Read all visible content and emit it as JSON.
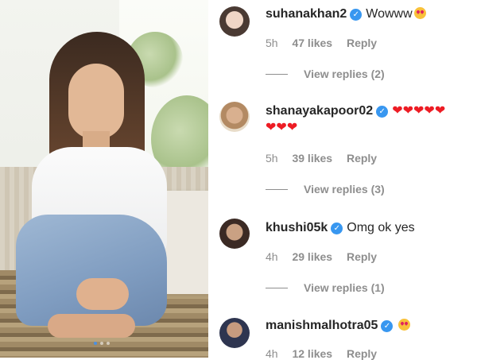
{
  "photo": {
    "carousel_dots": 3,
    "active_dot": 0
  },
  "comments": [
    {
      "username": "suhanakhan2",
      "text": "Wowww",
      "emoji": "heart-eyes",
      "time": "5h",
      "likes": "47 likes",
      "reply": "Reply",
      "view_replies": "View replies (2)"
    },
    {
      "username": "shanayakapoor02",
      "text": "❤❤❤❤❤",
      "text2": "❤❤❤",
      "time": "5h",
      "likes": "39 likes",
      "reply": "Reply",
      "view_replies": "View replies (3)"
    },
    {
      "username": "khushi05k",
      "text": "Omg ok yes",
      "time": "4h",
      "likes": "29 likes",
      "reply": "Reply",
      "view_replies": "View replies (1)"
    },
    {
      "username": "manishmalhotra05",
      "text": "",
      "emoji": "heart-eyes",
      "time": "4h",
      "likes": "12 likes",
      "reply": "Reply"
    }
  ],
  "colors": {
    "verified": "#3897f0",
    "meta": "#8e8e8e",
    "text": "#262626",
    "heart": "#ed1c24"
  }
}
